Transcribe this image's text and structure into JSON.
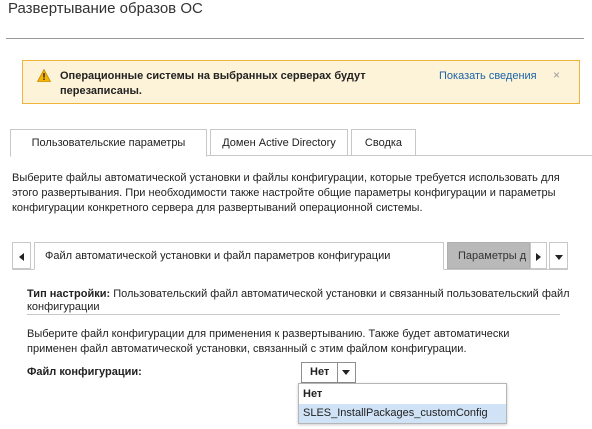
{
  "page_title": "Развертывание образов ОС",
  "alert": {
    "message": "Операционные системы на выбранных серверах будут перезаписаны.",
    "link": "Показать сведения",
    "close": "×",
    "icon": "warning-icon",
    "bg_color": "#fdf3d9",
    "border_color": "#f0b33c"
  },
  "tabs": [
    {
      "label": "Пользовательские параметры",
      "active": true
    },
    {
      "label": "Домен Active Directory",
      "active": false
    },
    {
      "label": "Сводка",
      "active": false
    }
  ],
  "description": "Выберите файлы автоматической установки и файлы конфигурации, которые требуется использовать для этого развертывания. При необходимости также настройте общие параметры конфигурации и параметры конфигурации конкретного сервера для развертываний операционной системы.",
  "subtabs": [
    {
      "label": "Файл автоматической установки и файл параметров конфигурации",
      "active": true
    },
    {
      "label": "Параметры д",
      "active": false
    }
  ],
  "setting_type": {
    "label": "Тип настройки:",
    "value": " Пользовательский файл автоматической установки и связанный пользовательский файл конфигурации"
  },
  "select_description": "Выберите файл конфигурации для применения к развертыванию. Также будет автоматически применен файл автоматической установки, связанный с этим файлом конфигурации.",
  "config_file": {
    "label": "Файл конфигурации:",
    "selected": "Нет",
    "options": [
      "Нет",
      "SLES_InstallPackages_customConfig"
    ]
  },
  "colors": {
    "link": "#1b63a8",
    "highlight": "#cfe2f6",
    "inactive_tab": "#b9b9b9"
  }
}
